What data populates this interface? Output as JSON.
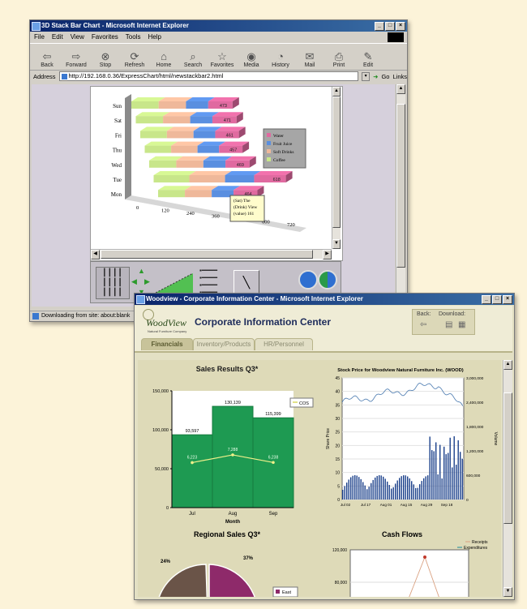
{
  "window1": {
    "title": "3D Stack Bar Chart - Microsoft Internet Explorer",
    "menu": [
      "File",
      "Edit",
      "View",
      "Favorites",
      "Tools",
      "Help"
    ],
    "toolbar": [
      {
        "label": "Back",
        "icon": "arrow-left-icon"
      },
      {
        "label": "Forward",
        "icon": "arrow-right-icon"
      },
      {
        "label": "Stop",
        "icon": "stop-icon"
      },
      {
        "label": "Refresh",
        "icon": "refresh-icon"
      },
      {
        "label": "Home",
        "icon": "home-icon"
      },
      {
        "label": "Search",
        "icon": "search-icon"
      },
      {
        "label": "Favorites",
        "icon": "favorites-icon"
      },
      {
        "label": "Media",
        "icon": "media-icon"
      },
      {
        "label": "History",
        "icon": "history-icon"
      },
      {
        "label": "Mail",
        "icon": "mail-icon"
      },
      {
        "label": "Print",
        "icon": "print-icon"
      },
      {
        "label": "Edit",
        "icon": "edit-icon"
      }
    ],
    "address_label": "Address",
    "address_value": "http://192.168.0.36/ExpressChart/html/newstackbar2.html",
    "go_label": "Go",
    "links_label": "Links",
    "status": "Downloading from site: about:blank"
  },
  "chart1": {
    "categories": [
      "Sun",
      "Sat",
      "Fri",
      "Thu",
      "Wed",
      "Tue",
      "Mon"
    ],
    "totals": [
      "473",
      "471",
      "461",
      "457",
      "469",
      "618",
      "464"
    ],
    "xticks": [
      "0",
      "120",
      "240",
      "360",
      "480",
      "600",
      "720"
    ],
    "legend": [
      "Water",
      "Fruit Juice",
      "Soft Drinks",
      "Coffee"
    ],
    "colors": {
      "water": "#e06aa0",
      "juice": "#5a8fe0",
      "soft": "#efb89a",
      "coffee": "#c8e68a"
    },
    "tooltip": "(Sat) The (Drink) View (value) 161"
  },
  "window2": {
    "title": "Woodview - Corporate Information Center - Microsoft Internet Explorer",
    "logo_text": "WoodView",
    "logo_sub": "Natural Furniture Company",
    "header_title": "Corporate Information Center",
    "back_label": "Back:",
    "download_label": "Download:",
    "tabs": [
      "Financials",
      "Inventory/Products",
      "HR/Personnel"
    ]
  },
  "sales": {
    "title": "Sales Results Q3*",
    "categories": [
      "Jul",
      "Aug",
      "Sep"
    ],
    "bar_values": [
      93597,
      130139,
      115399
    ],
    "bar_labels": [
      "93,597",
      "130,139",
      "115,399"
    ],
    "line_values": [
      6223,
      7288,
      6238
    ],
    "line_labels": [
      "6,223",
      "7,288",
      "6,238"
    ],
    "yticks": [
      "150,000",
      "100,000",
      "50,000",
      "0"
    ],
    "xlabel": "Month",
    "legend": "COS"
  },
  "stock": {
    "title": "Stock Price for Woodview Natural Furniture Inc. (WOOD)",
    "left_ticks": [
      "45",
      "40",
      "35",
      "30",
      "25",
      "20",
      "15",
      "10",
      "5",
      "0"
    ],
    "right_ticks": [
      "3,000,000",
      "2,400,000",
      "1,800,000",
      "1,200,000",
      "600,000",
      "0"
    ],
    "xticks": [
      "Jul 02",
      "Jul 17",
      "Aug 01",
      "Aug 15",
      "Aug 29",
      "Sep 18"
    ],
    "ylabel_left": "Share Price",
    "ylabel_right": "Volume"
  },
  "regional": {
    "title": "Regional Sales Q3*",
    "labels": [
      "24%",
      "37%"
    ],
    "legend": [
      "East"
    ]
  },
  "cashflow": {
    "title": "Cash Flows",
    "legend": [
      "Receipts",
      "Expenditures"
    ],
    "yticks": [
      "120,000",
      "80,000"
    ]
  }
}
